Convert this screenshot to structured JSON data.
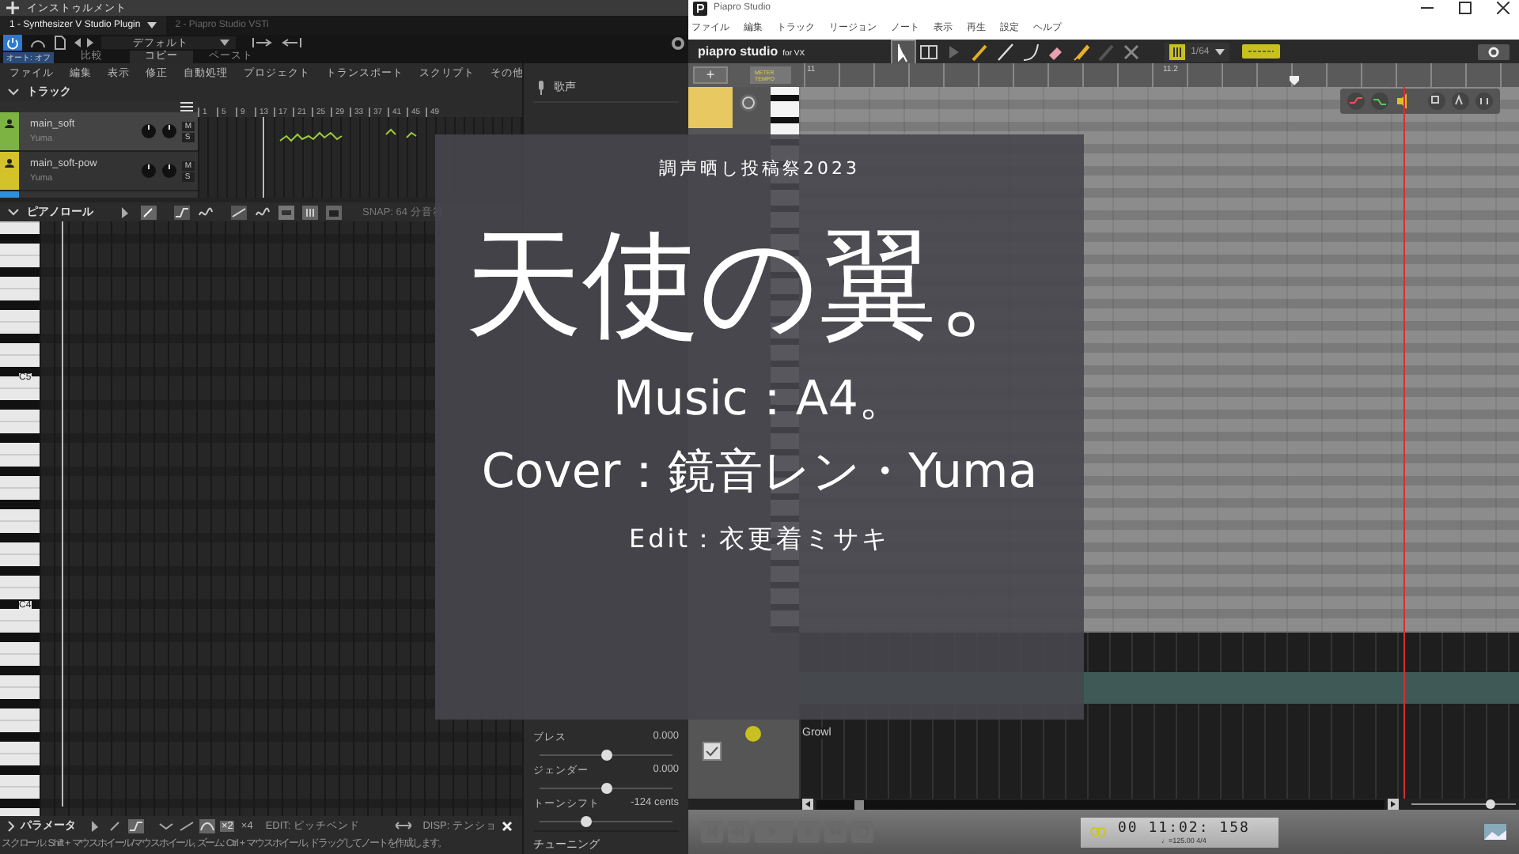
{
  "host": {
    "header": "インストゥルメント",
    "tabs": [
      {
        "label": "1 - Synthesizer V Studio Plugin",
        "selected": true
      },
      {
        "label": "2 - Piapro Studio VSTi",
        "selected": false
      }
    ],
    "preset": "デフォルト",
    "auto": "オート: オフ",
    "compare": "比較",
    "copy": "コピー",
    "paste": "ペースト"
  },
  "svs": {
    "menu": [
      "ファイル",
      "編集",
      "表示",
      "修正",
      "自動処理",
      "プロジェクト",
      "トランスポート",
      "スクリプト",
      "その他"
    ],
    "tracks_title": "トラック",
    "ruler": [
      "1",
      "5",
      "9",
      "13",
      "17",
      "21",
      "25",
      "29",
      "33",
      "37",
      "41",
      "45",
      "49"
    ],
    "tracks": [
      {
        "name": "main_soft",
        "singer": "Yuma",
        "mute": "M",
        "solo": "S",
        "color": "#7cb342",
        "selected": true
      },
      {
        "name": "main_soft-pow",
        "singer": "Yuma",
        "mute": "M",
        "solo": "S",
        "color": "#d4c22a",
        "selected": false
      },
      {
        "color": "#2f8fd8",
        "selected": false
      }
    ],
    "piano_roll": {
      "title": "ピアノロール",
      "snap": "SNAP:  64 分音符",
      "octaves": [
        "C5",
        "C4"
      ]
    },
    "params": {
      "title": "パラメータ",
      "x2": "×2",
      "x4": "×4",
      "edit": "EDIT:  ピッチベンド",
      "disp": "DISP:  テンショ"
    },
    "status": "スクロール: Shift + マウスホイール/マウスホイール, ズーム: Ctrl + マウスホイール, ドラッグしてノートを作成します。",
    "side": {
      "title": "歌声",
      "sliders": [
        {
          "label": "ブレス",
          "reading": "0.000",
          "level": 0.5
        },
        {
          "label": "ジェンダー",
          "reading": "0.000",
          "level": 0.5
        },
        {
          "label": "トーンシフト",
          "reading": "-124 cents",
          "level": 0.35
        }
      ],
      "footer": "チューニング"
    }
  },
  "piapro": {
    "title": "Piapro Studio",
    "menu": [
      "ファイル",
      "編集",
      "トラック",
      "リージョン",
      "ノート",
      "表示",
      "再生",
      "設定",
      "ヘルプ"
    ],
    "logo": "piapro studio",
    "logo_suffix": "for VX",
    "tools": [
      {
        "kind": "pointer",
        "selected": true
      },
      {
        "kind": "range",
        "selected": false
      },
      {
        "kind": "play",
        "selected": false
      },
      {
        "kind": "pencil",
        "selected": false
      },
      {
        "kind": "line",
        "selected": false
      },
      {
        "kind": "curve",
        "selected": false
      },
      {
        "kind": "eraser",
        "selected": false
      },
      {
        "kind": "brush",
        "selected": false
      },
      {
        "kind": "pen",
        "selected": false
      },
      {
        "kind": "cross",
        "selected": false
      }
    ],
    "quantize": "1/64",
    "add": "+",
    "meter": "METER",
    "tempo_tag": "TEMPO",
    "ruler": [
      "11",
      "11.2"
    ],
    "lane": "Growl",
    "time": "00 11:02: 158",
    "tempo": "♩=125.00  4/4"
  },
  "overlay": {
    "event": "調声晒し投稿祭2023",
    "title": "天使の翼。",
    "music": "Music：A4。",
    "cover": "Cover：鏡音レン・Yuma",
    "edit": "Edit：衣更着ミサキ"
  }
}
